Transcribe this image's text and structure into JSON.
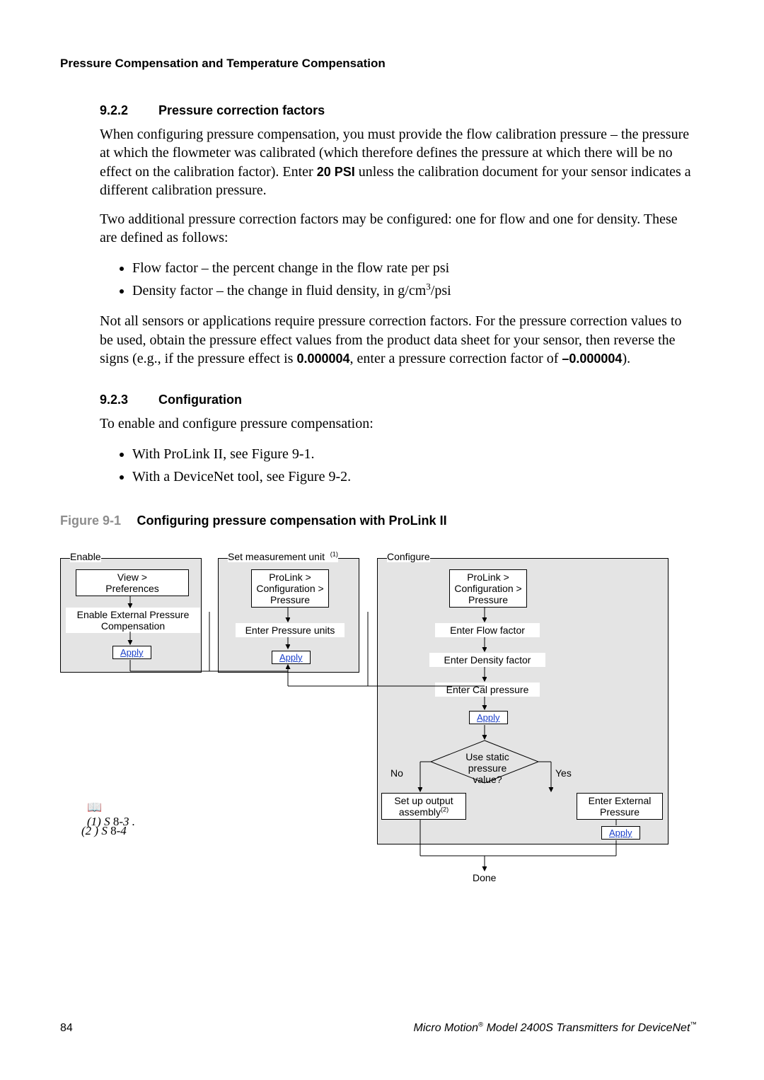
{
  "running_head": "Pressure Compensation and Temperature Compensation",
  "s922": {
    "num": "9.2.2",
    "title": "Pressure correction factors",
    "p1a": "When configuring pressure compensation, you must provide the flow calibration pressure – the pressure at which the flowmeter was calibrated (which therefore defines the pressure at which there will be no effect on the calibration factor). Enter ",
    "p1b": "20 PSI",
    "p1c": " unless the calibration document for your sensor indicates a different calibration pressure.",
    "p2": "Two additional pressure correction factors may be configured: one for flow and one for density. These are defined as follows:",
    "li1": "Flow factor – the percent change in the flow rate per psi",
    "li2a": "Density factor – the change in fluid density, in g/cm",
    "li2b": "/psi",
    "p3a": "Not all sensors or applications require pressure correction factors. For the pressure correction values to be used, obtain the pressure effect values from the product data sheet for your sensor, then reverse the signs (e.g., if the pressure effect is ",
    "p3b": "0.000004",
    "p3c": ", enter a pressure correction factor of ",
    "p3d": "–0.000004",
    "p3e": ")."
  },
  "s923": {
    "num": "9.2.3",
    "title": "Configuration",
    "p1": "To enable and configure pressure compensation:",
    "li1": "With ProLink II, see Figure 9-1.",
    "li2": "With a DeviceNet tool, see Figure 9-2."
  },
  "fig": {
    "label": "Figure 9-1",
    "caption": "Configuring pressure compensation with ProLink II",
    "enable_title": "Enable",
    "set_title": "Set measurement unit",
    "set_title_sup": "(1)",
    "config_title": "Configure",
    "view_pref": "View >\nPreferences",
    "enable_ext": "Enable External Pressure Compensation",
    "prolink_press": "ProLink >\nConfiguration >\nPressure",
    "enter_units": "Enter Pressure units",
    "enter_flow": "Enter Flow factor",
    "enter_density": "Enter Density factor",
    "enter_cal": "Enter Cal pressure",
    "decision": "Use static\npressure value?",
    "no": "No",
    "yes": "Yes",
    "setup_output_a": "Set up output",
    "setup_output_b": "assembly",
    "setup_output_sup": "(2)",
    "enter_ext": "Enter External\nPressure",
    "apply": "Apply",
    "done": "Done",
    "foot1_a": "(1) S",
    "foot1_b": " 8-",
    "foot1_c": "3 .",
    "foot2_a": "(2 ) S",
    "foot2_b": " 8-",
    "foot2_c": "4"
  },
  "footer": {
    "page": "84",
    "product_a": "Micro Motion",
    "product_b": " Model 2400S Transmitters for DeviceNet"
  }
}
